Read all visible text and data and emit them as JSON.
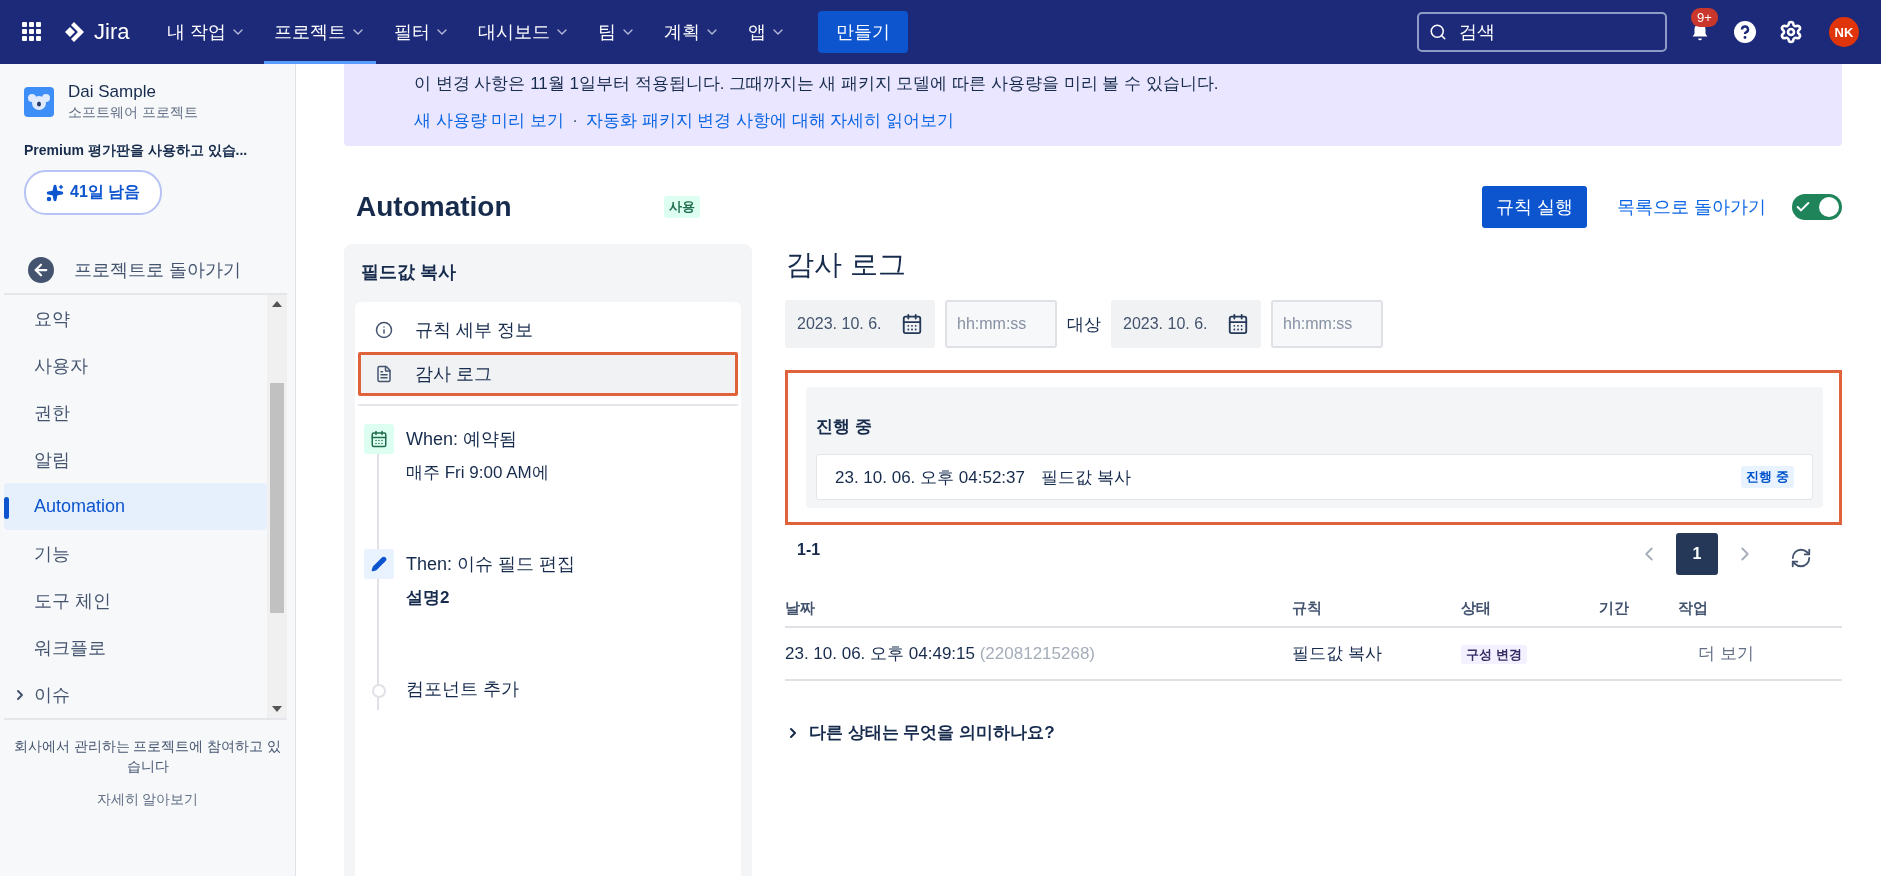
{
  "topnav": {
    "product": "Jira",
    "menus": [
      {
        "label": "내 작업",
        "selected": false
      },
      {
        "label": "프로젝트",
        "selected": true
      },
      {
        "label": "필터",
        "selected": false
      },
      {
        "label": "대시보드",
        "selected": false
      },
      {
        "label": "팀",
        "selected": false
      },
      {
        "label": "계획",
        "selected": false
      },
      {
        "label": "앱",
        "selected": false
      }
    ],
    "create_button": "만들기",
    "search": {
      "placeholder": "검색"
    },
    "notification_badge": "9+",
    "avatar": "NK"
  },
  "sidebar": {
    "project": {
      "name": "Dai Sample",
      "type": "소프트웨어 프로젝트"
    },
    "trial_text": "Premium 평가판을 사용하고 있습...",
    "trial_button": "41일 남음",
    "back_link": "프로젝트로 돌아가기",
    "items": [
      {
        "label": "요약",
        "selected": false,
        "expandable": false
      },
      {
        "label": "사용자",
        "selected": false,
        "expandable": false
      },
      {
        "label": "권한",
        "selected": false,
        "expandable": false
      },
      {
        "label": "알림",
        "selected": false,
        "expandable": false
      },
      {
        "label": "Automation",
        "selected": true,
        "expandable": false
      },
      {
        "label": "기능",
        "selected": false,
        "expandable": false
      },
      {
        "label": "도구 체인",
        "selected": false,
        "expandable": false
      },
      {
        "label": "워크플로",
        "selected": false,
        "expandable": false
      },
      {
        "label": "이슈",
        "selected": false,
        "expandable": true
      }
    ],
    "footer_text": "회사에서 관리하는 프로젝트에 참여하고 있습니다",
    "footer_link": "자세히 알아보기"
  },
  "banner": {
    "text": "이 변경 사항은 11월 1일부터 적용됩니다. 그때까지는 새 패키지 모델에 따른 사용량을 미리 볼 수 있습니다.",
    "links": [
      "새 사용량 미리 보기",
      "자동화 패키지 변경 사항에 대해 자세히 읽어보기"
    ],
    "separator": "·"
  },
  "header": {
    "title": "Automation",
    "status_badge": "사용",
    "run_button": "규칙 실행",
    "back_link": "목록으로 돌아가기",
    "enabled": true
  },
  "rule_panel": {
    "name": "필드값 복사",
    "nav": [
      {
        "kind": "info",
        "label": "규칙 세부 정보",
        "selected": false,
        "highlighted": false
      },
      {
        "kind": "log",
        "label": "감사 로그",
        "selected": true,
        "highlighted": true
      }
    ],
    "steps": [
      {
        "kind": "trigger",
        "label": "When: 예약됨",
        "detail": "매주 Fri 9:00 AM에"
      },
      {
        "kind": "action",
        "label": "Then: 이슈 필드 편집",
        "detail": "설명2"
      },
      {
        "kind": "add",
        "label": "컴포넌트 추가"
      }
    ]
  },
  "audit_log": {
    "title": "감사 로그",
    "from_date": "2023. 10. 6.",
    "from_time": {
      "placeholder": "hh:mm:ss"
    },
    "to_label": "대상",
    "to_date": "2023. 10. 6.",
    "to_time": {
      "placeholder": "hh:mm:ss"
    },
    "in_progress": {
      "title": "진행 중",
      "highlighted": true,
      "items": [
        {
          "time": "23. 10. 06. 오후 04:52:37",
          "rule": "필드값 복사",
          "status": "진행 중"
        }
      ]
    },
    "range": "1-1",
    "pages": [
      {
        "label": "1",
        "selected": true
      }
    ],
    "table": {
      "columns": [
        "날짜",
        "규칙",
        "상태",
        "기간",
        "작업"
      ],
      "rows": [
        {
          "date": "23. 10. 06. 오후 04:49:15",
          "id": "(22081215268)",
          "rule": "필드값 복사",
          "status": "구성 변경",
          "action": "더 보기"
        }
      ]
    },
    "help": {
      "label": "다른 상태는 무엇을 의미하나요?",
      "expanded": false
    }
  }
}
